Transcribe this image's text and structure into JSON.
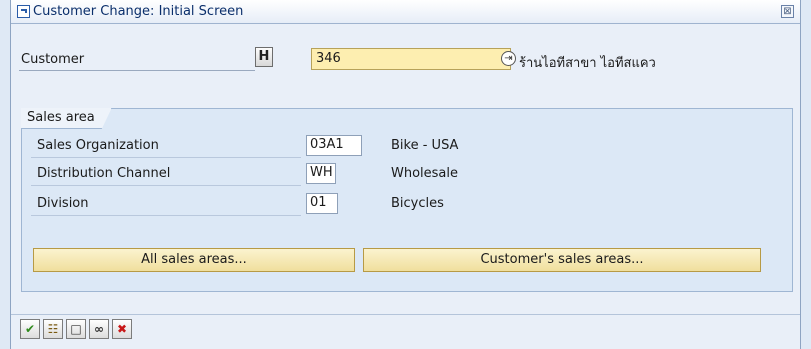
{
  "window": {
    "title": "Customer Change: Initial Screen",
    "close_symbol": "⊠"
  },
  "customer": {
    "label": "Customer",
    "matchcode_symbol": "H",
    "value": "346",
    "nav_symbol": "⇥",
    "name": "ร้านไอทีสาขา ไอทีสแคว"
  },
  "sales_area": {
    "title": "Sales area",
    "fields": [
      {
        "label": "Sales Organization",
        "value": "03A1",
        "description": "Bike - USA"
      },
      {
        "label": "Distribution Channel",
        "value": "WH",
        "description": "Wholesale"
      },
      {
        "label": "Division",
        "value": "01",
        "description": "Bicycles"
      }
    ],
    "all_sales_areas_label": "All sales areas...",
    "customers_sales_areas_label": "Customer's sales areas..."
  },
  "toolbar": {
    "enter_symbol": "✔",
    "structure_symbol": "☷",
    "create_symbol": "□",
    "glasses_symbol": "∞",
    "cancel_symbol": "✖"
  },
  "icons": [
    "title-icon",
    "close-icon",
    "matchcode-icon",
    "navigation-icon",
    "enter-icon",
    "structure-icon",
    "create-icon",
    "display-icon",
    "cancel-icon"
  ],
  "colors": {
    "required_field": "#fdeeb0",
    "button": "#f0df9d",
    "group_background": "#dce8f6",
    "enter_green": "#2f8a1c",
    "cancel_red": "#c81818"
  }
}
